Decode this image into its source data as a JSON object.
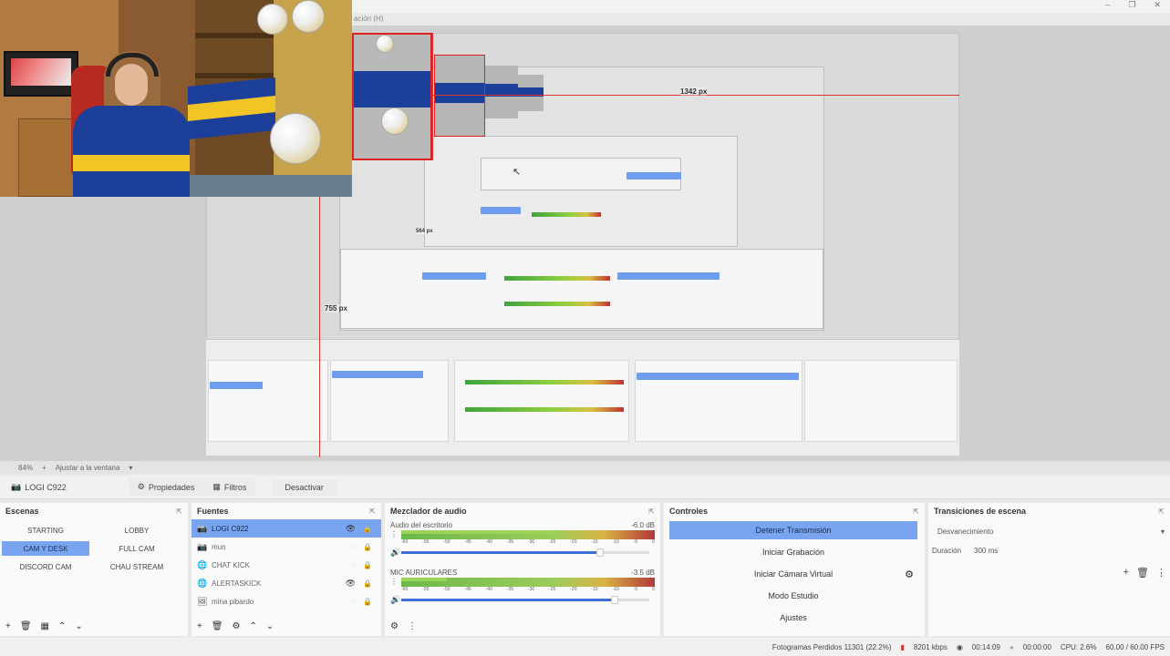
{
  "window": {
    "menu_fragment": "ación (H)",
    "controls": [
      "–",
      "❐",
      "✕"
    ]
  },
  "preview": {
    "horizontal_guide_label": "1342 px",
    "vertical_guide_label": "755 px",
    "side_guide_label": "564 px"
  },
  "zoom": {
    "level": "84%",
    "fit_label": "Ajustar a la ventana"
  },
  "source_toolbar": {
    "source_name": "LOGI C922",
    "properties": "Propiedades",
    "filters": "Filtros",
    "deactivate": "Desactivar"
  },
  "scenes": {
    "title": "Escenas",
    "items": [
      {
        "label": "STARTING",
        "active": false
      },
      {
        "label": "LOBBY",
        "active": false
      },
      {
        "label": "CAM Y DESK",
        "active": true
      },
      {
        "label": "FULL CAM",
        "active": false
      },
      {
        "label": "DISCORD CAM",
        "active": false
      },
      {
        "label": "CHAU STREAM",
        "active": false
      }
    ]
  },
  "sources": {
    "title": "Fuentes",
    "items": [
      {
        "label": "LOGI C922",
        "icon": "camera-icon",
        "visible": true,
        "locked": false,
        "active": true
      },
      {
        "label": "mun",
        "icon": "camera-icon",
        "visible": false,
        "locked": true,
        "active": false
      },
      {
        "label": "CHAT KICK",
        "icon": "globe-icon",
        "visible": false,
        "locked": true,
        "active": false
      },
      {
        "label": "ALERTASKICK",
        "icon": "globe-icon",
        "visible": true,
        "locked": true,
        "active": false
      },
      {
        "label": "mina pibardo",
        "icon": "image-icon",
        "visible": false,
        "locked": true,
        "active": false
      }
    ]
  },
  "mixer": {
    "title": "Mezclador de audio",
    "ticks": [
      "-60",
      "-55",
      "-50",
      "-45",
      "-40",
      "-35",
      "-30",
      "-25",
      "-20",
      "-15",
      "-10",
      "-5",
      "0"
    ],
    "tracks": [
      {
        "name": "Audio del escritorio",
        "db": "-6.0 dB",
        "level": 0.62,
        "volume": 0.8
      },
      {
        "name": "MIC AURICULARES",
        "db": "-3.5 dB",
        "level": 0.18,
        "volume": 0.86
      }
    ]
  },
  "controls": {
    "title": "Controles",
    "stop_stream": "Detener Transmisión",
    "start_recording": "Iniciar Grabación",
    "virtual_camera": "Iniciar Cámara Virtual",
    "studio_mode": "Modo Estudio",
    "settings": "Ajustes"
  },
  "transitions": {
    "title": "Transiciones de escena",
    "selected": "Desvanecimiento",
    "duration_label": "Duración",
    "duration_value": "300 ms"
  },
  "status": {
    "dropped_frames": "Fotogramas Perdidos 11301 (22.2%)",
    "bitrate": "8201 kbps",
    "stream_time": "00:14:09",
    "record_time": "00:00:00",
    "cpu": "CPU: 2.6%",
    "fps": "60.00 / 60.00 FPS"
  },
  "colors": {
    "accent": "#79a5f0",
    "guide": "#dd3333",
    "meter_green": "#6bb84a",
    "meter_red": "#b4363a",
    "slider": "#3e6ed8"
  }
}
